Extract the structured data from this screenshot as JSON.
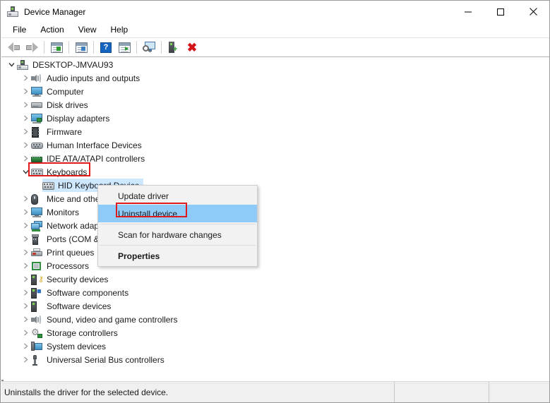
{
  "window": {
    "title": "Device Manager",
    "app_icon": "computer-icon",
    "controls": {
      "minimize": "minimize-icon",
      "maximize": "maximize-icon",
      "close": "close-icon"
    }
  },
  "menubar": {
    "items": [
      {
        "label": "File"
      },
      {
        "label": "Action"
      },
      {
        "label": "View"
      },
      {
        "label": "Help"
      }
    ]
  },
  "toolbar": {
    "buttons": [
      {
        "name": "back-button",
        "icon": "back-arrow-icon",
        "tooltip": "Back"
      },
      {
        "name": "forward-button",
        "icon": "forward-arrow-icon",
        "tooltip": "Forward"
      },
      {
        "name": "show-hide-console-tree-button",
        "icon": "console-tree-icon",
        "tooltip": "Show/Hide Console Tree"
      },
      {
        "name": "properties-button",
        "icon": "properties-window-icon",
        "tooltip": "Properties"
      },
      {
        "name": "help-button",
        "icon": "help-icon",
        "tooltip": "Help"
      },
      {
        "name": "update-driver-button",
        "icon": "update-driver-icon",
        "tooltip": "Update driver"
      },
      {
        "name": "scan-for-hardware-changes-button",
        "icon": "scan-hardware-icon",
        "tooltip": "Scan for hardware changes"
      },
      {
        "name": "enable-device-button",
        "icon": "enable-device-icon",
        "tooltip": "Enable device"
      },
      {
        "name": "uninstall-device-button",
        "icon": "red-x-icon",
        "tooltip": "Uninstall device"
      }
    ]
  },
  "tree": {
    "root": {
      "label": "DESKTOP-JMVAU93",
      "icon": "computer-icon",
      "expanded": true
    },
    "items": [
      {
        "label": "Audio inputs and outputs",
        "icon": "speaker-icon",
        "expanded": false,
        "indent": 1
      },
      {
        "label": "Computer",
        "icon": "monitor-icon",
        "expanded": false,
        "indent": 1
      },
      {
        "label": "Disk drives",
        "icon": "disk-drive-icon",
        "expanded": false,
        "indent": 1
      },
      {
        "label": "Display adapters",
        "icon": "display-adapter-icon",
        "expanded": false,
        "indent": 1
      },
      {
        "label": "Firmware",
        "icon": "firmware-chip-icon",
        "expanded": false,
        "indent": 1
      },
      {
        "label": "Human Interface Devices",
        "icon": "hid-gamepad-icon",
        "expanded": false,
        "indent": 1
      },
      {
        "label": "IDE ATA/ATAPI controllers",
        "icon": "ide-controller-icon",
        "expanded": false,
        "indent": 1
      },
      {
        "label": "Keyboards",
        "icon": "keyboard-icon",
        "expanded": true,
        "indent": 1,
        "highlighted_box": true
      },
      {
        "label": "HID Keyboard Device",
        "icon": "keyboard-icon",
        "expanded": null,
        "indent": 2,
        "selected": true
      },
      {
        "label": "Mice and other pointing devices",
        "icon": "mouse-icon",
        "expanded": false,
        "indent": 1
      },
      {
        "label": "Monitors",
        "icon": "monitor-icon",
        "expanded": false,
        "indent": 1
      },
      {
        "label": "Network adapters",
        "icon": "network-adapter-icon",
        "expanded": false,
        "indent": 1
      },
      {
        "label": "Ports (COM & LPT)",
        "icon": "port-icon",
        "expanded": false,
        "indent": 1
      },
      {
        "label": "Print queues",
        "icon": "printer-icon",
        "expanded": false,
        "indent": 1
      },
      {
        "label": "Processors",
        "icon": "processor-icon",
        "expanded": false,
        "indent": 1
      },
      {
        "label": "Security devices",
        "icon": "security-device-icon",
        "expanded": false,
        "indent": 1
      },
      {
        "label": "Software components",
        "icon": "software-component-icon",
        "expanded": false,
        "indent": 1
      },
      {
        "label": "Software devices",
        "icon": "software-device-icon",
        "expanded": false,
        "indent": 1
      },
      {
        "label": "Sound, video and game controllers",
        "icon": "speaker-icon",
        "expanded": false,
        "indent": 1
      },
      {
        "label": "Storage controllers",
        "icon": "storage-controller-icon",
        "expanded": false,
        "indent": 1
      },
      {
        "label": "System devices",
        "icon": "system-device-icon",
        "expanded": false,
        "indent": 1
      },
      {
        "label": "Universal Serial Bus controllers",
        "icon": "usb-controller-icon",
        "expanded": false,
        "indent": 1
      }
    ]
  },
  "context_menu": {
    "items": [
      {
        "label": "Update driver",
        "highlighted": false,
        "bold": false
      },
      {
        "label": "Uninstall device",
        "highlighted": true,
        "bold": false,
        "annotated": true
      },
      {
        "separator_after": true
      },
      {
        "label": "Scan for hardware changes",
        "highlighted": false,
        "bold": false
      },
      {
        "label": "Properties",
        "highlighted": false,
        "bold": true
      }
    ]
  },
  "statusbar": {
    "message": "Uninstalls the driver for the selected device.",
    "pane2": "",
    "pane3": ""
  },
  "colors": {
    "selection": "#cde8ff",
    "menu_highlight": "#8fcbf8",
    "annotation_red": "#e01b1b",
    "titlebar": "#ffffff",
    "statusbar": "#f0f0f0",
    "close_hover": "#e81123"
  }
}
